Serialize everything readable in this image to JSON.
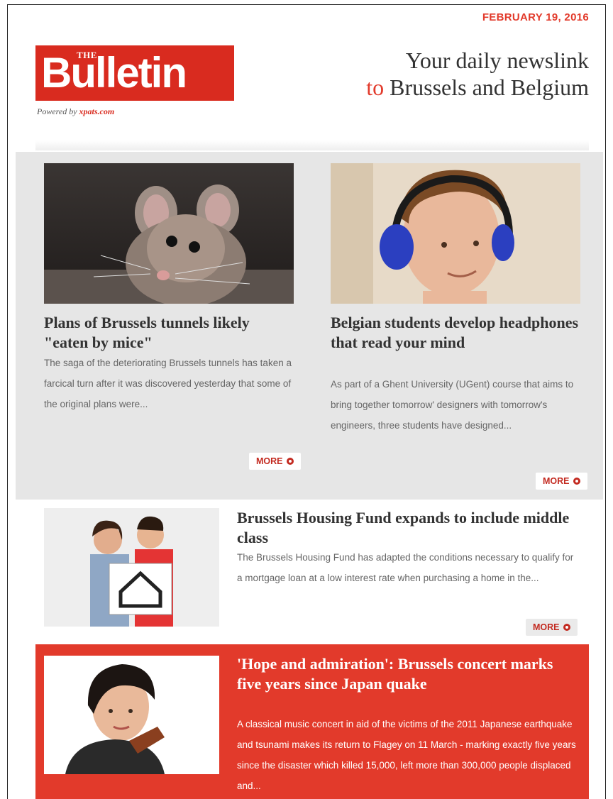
{
  "header": {
    "date": "FEBRUARY 19, 2016",
    "logo_the": "THE",
    "logo_name": "Bulletin",
    "powered_prefix": "Powered by",
    "powered_brand": "xpats.com",
    "tagline_line1": "Your daily newslink",
    "tagline_to": "to",
    "tagline_line2": "Brussels and Belgium"
  },
  "stories": [
    {
      "title": "Plans of Brussels tunnels likely \"eaten by mice\"",
      "text": "The saga of the deteriorating Brussels tunnels has taken a farcical turn after it was discovered yesterday that some of the original plans were...",
      "more": "MORE"
    },
    {
      "title": "Belgian students develop headphones that read your mind",
      "text": "As part of a Ghent University (UGent) course that aims to bring together tomorrow' designers with tomorrow's engineers, three students have designed...",
      "more": "MORE"
    },
    {
      "title": "Brussels Housing Fund expands to include middle class",
      "text": "The Brussels Housing Fund has adapted the conditions necessary to qualify for a mortgage loan at a low interest rate when purchasing a home in the...",
      "more": "MORE"
    },
    {
      "title": "'Hope and admiration': Brussels concert marks five years since Japan quake",
      "text": "A classical music concert in aid of the victims of the 2011 Japanese earthquake and tsunami makes its return to Flagey on 11 March - marking exactly five years since the disaster which killed 15,000, left more than 300,000 people displaced and..."
    }
  ],
  "colors": {
    "brand_red": "#d92b1f",
    "accent_red": "#e23a2b",
    "panel_grey": "#e6e6e6"
  }
}
